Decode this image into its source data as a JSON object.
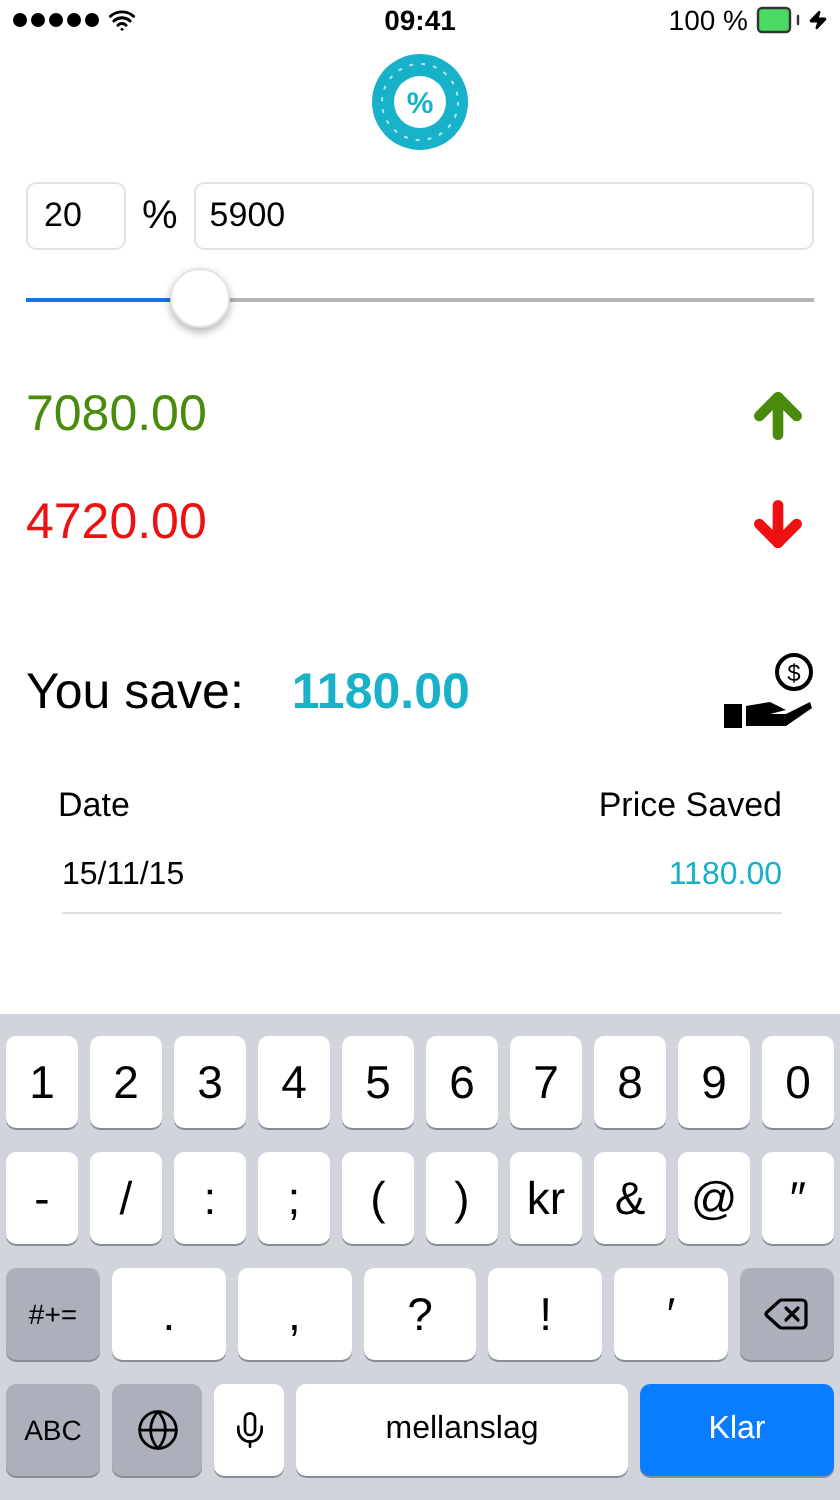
{
  "status_bar": {
    "time": "09:41",
    "battery": "100 %"
  },
  "logo": {
    "symbol": "%"
  },
  "percent_sign": "%",
  "percent_field": {
    "value": "20"
  },
  "amount_field": {
    "value": "5900"
  },
  "slider": {
    "level": 0.22
  },
  "results": [
    {
      "kind": "up",
      "value": "7080.00",
      "color": "#4a8a0c"
    },
    {
      "kind": "down",
      "value": "4720.00",
      "color": "#ee1111"
    }
  ],
  "savings": {
    "label": "You save:",
    "value": "1180.00",
    "coin_symbol": "$"
  },
  "table": {
    "columns": [
      "Date",
      "Price Saved"
    ],
    "rows": [
      {
        "date": "15/11/15",
        "price": "1180.00"
      }
    ]
  },
  "keyboard": {
    "number_keys": [
      {
        "kind": "char",
        "label": "1"
      },
      {
        "kind": "char",
        "label": "2"
      },
      {
        "kind": "char",
        "label": "3"
      },
      {
        "kind": "char",
        "label": "4"
      },
      {
        "kind": "char",
        "label": "5"
      },
      {
        "kind": "char",
        "label": "6"
      },
      {
        "kind": "char",
        "label": "7"
      },
      {
        "kind": "char",
        "label": "8"
      },
      {
        "kind": "char",
        "label": "9"
      },
      {
        "kind": "char",
        "label": "0"
      }
    ],
    "symbol_keys": [
      {
        "kind": "char",
        "label": "-"
      },
      {
        "kind": "char",
        "label": "/"
      },
      {
        "kind": "char",
        "label": ":"
      },
      {
        "kind": "char",
        "label": ";"
      },
      {
        "kind": "char",
        "label": "("
      },
      {
        "kind": "char",
        "label": ")"
      },
      {
        "kind": "char",
        "label": "kr"
      },
      {
        "kind": "char",
        "label": "&"
      },
      {
        "kind": "char",
        "label": "@"
      },
      {
        "kind": "char",
        "label": "″"
      }
    ],
    "punctuation_keys": [
      {
        "kind": "special",
        "label": "#+="
      },
      {
        "kind": "wide",
        "label": "."
      },
      {
        "kind": "wide",
        "label": ","
      },
      {
        "kind": "wide",
        "label": "?"
      },
      {
        "kind": "wide",
        "label": "!"
      },
      {
        "kind": "wide",
        "label": "′"
      },
      {
        "kind": "backspace"
      }
    ],
    "bottom_keys": [
      {
        "kind": "special",
        "label": "ABC"
      },
      {
        "kind": "globe"
      },
      {
        "kind": "mic"
      },
      {
        "kind": "space",
        "label": "mellanslag"
      },
      {
        "kind": "done",
        "label": "Klar"
      }
    ]
  }
}
